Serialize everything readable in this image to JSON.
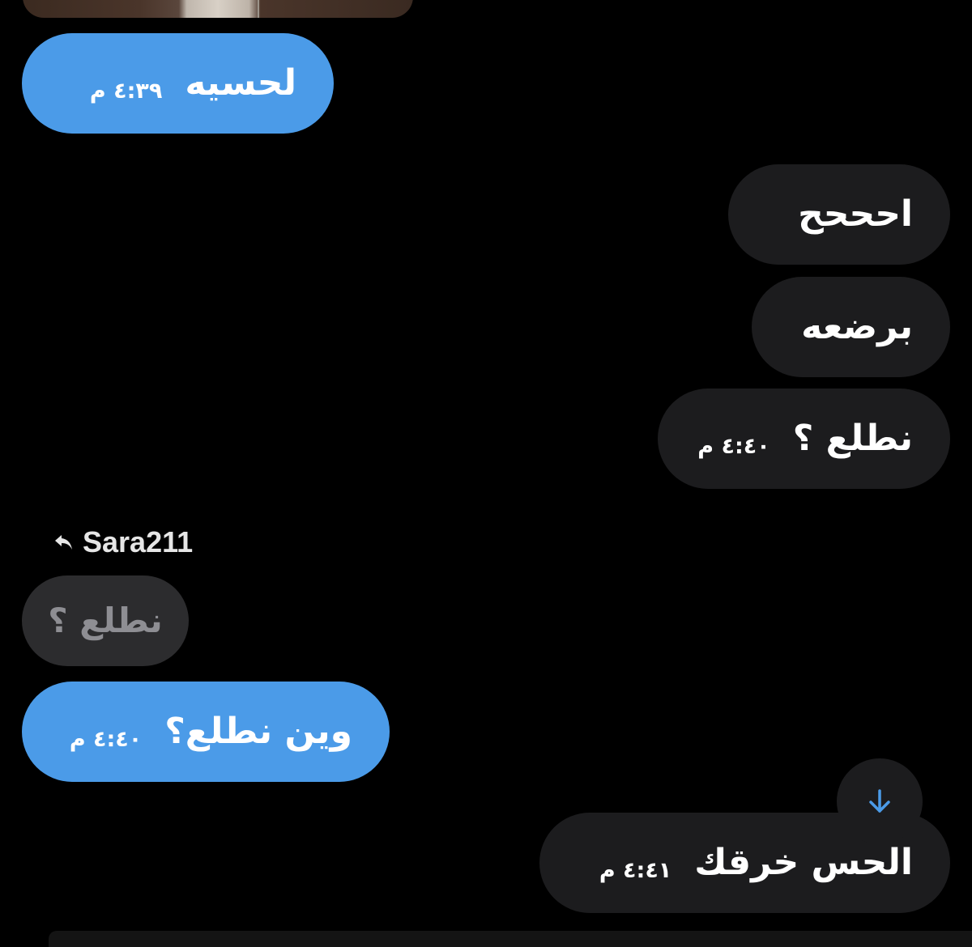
{
  "messages": [
    {
      "id": "m1",
      "direction": "sent",
      "text": "لحسيه",
      "time": "٤:٣٩ م"
    },
    {
      "id": "m2",
      "direction": "received",
      "text": "احححح",
      "time": ""
    },
    {
      "id": "m3",
      "direction": "received",
      "text": "برضعه",
      "time": ""
    },
    {
      "id": "m4",
      "direction": "received",
      "text": "نطلع ؟",
      "time": "٤:٤٠ م"
    },
    {
      "id": "m5",
      "direction": "sent",
      "text": "وين نطلع؟",
      "time": "٤:٤٠ م",
      "reply_to": {
        "user": "Sara211",
        "text": "نطلع ؟"
      }
    },
    {
      "id": "m6",
      "direction": "received",
      "text": "الحس خرقك",
      "time": "٤:٤١ م"
    }
  ],
  "scroll_button": {
    "icon": "arrow-down-icon"
  },
  "colors": {
    "background": "#000000",
    "sent_bubble": "#4b9be8",
    "received_bubble": "#1c1c1e",
    "quoted_bubble": "#2c2c2e",
    "quoted_text": "#8e8e93",
    "scroll_arrow": "#4b9be8"
  }
}
